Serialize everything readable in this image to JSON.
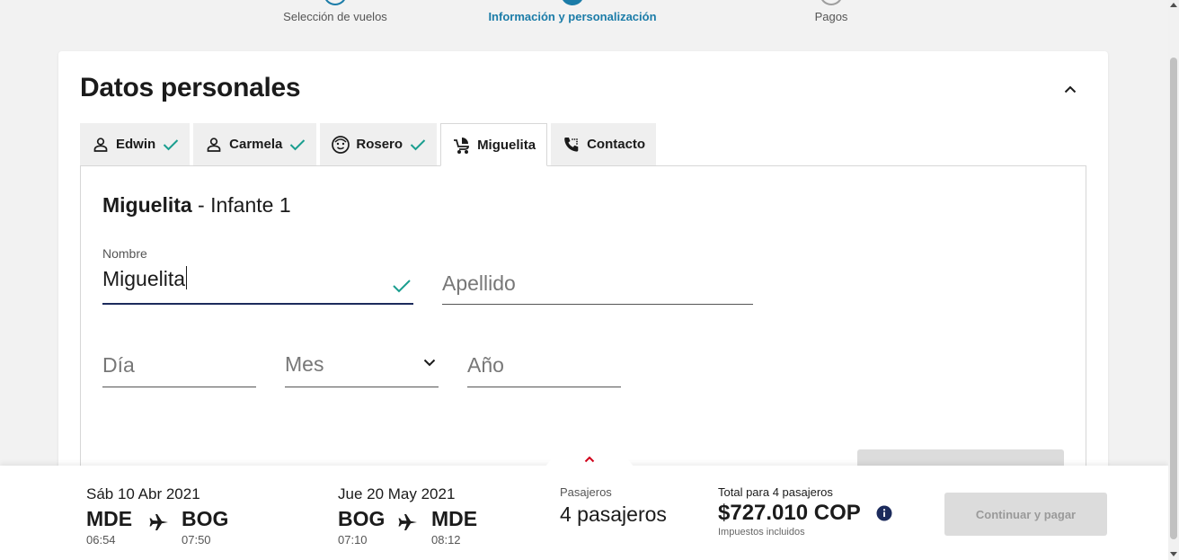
{
  "stepper": {
    "steps": [
      {
        "label": "Selección de vuelos"
      },
      {
        "label": "Información y personalización"
      },
      {
        "label": "Pagos"
      }
    ]
  },
  "card": {
    "title": "Datos personales"
  },
  "tabs": [
    {
      "label": "Edwin",
      "icon": "person-icon",
      "done": true
    },
    {
      "label": "Carmela",
      "icon": "person-icon",
      "done": true
    },
    {
      "label": "Rosero",
      "icon": "child-face-icon",
      "done": true
    },
    {
      "label": "Miguelita",
      "icon": "baby-stroller-icon",
      "done": false
    },
    {
      "label": "Contacto",
      "icon": "phone-icon",
      "done": false
    }
  ],
  "panel": {
    "name": "Miguelita",
    "subtitle": " - Infante 1"
  },
  "form": {
    "first_name_label": "Nombre",
    "first_name_value": "Miguelita",
    "last_name_placeholder": "Apellido",
    "day_placeholder": "Día",
    "month_placeholder": "Mes",
    "year_placeholder": "Año"
  },
  "flights": [
    {
      "date": "Sáb 10 Abr 2021",
      "origin": "MDE",
      "origin_time": "06:54",
      "destination": "BOG",
      "destination_time": "07:50"
    },
    {
      "date": "Jue 20 May 2021",
      "origin": "BOG",
      "origin_time": "07:10",
      "destination": "MDE",
      "destination_time": "08:12"
    }
  ],
  "passengers": {
    "label": "Pasajeros",
    "value": "4 pasajeros"
  },
  "total": {
    "label": "Total para 4 pasajeros",
    "value": "$727.010 COP",
    "note": "Impuestos incluidos"
  },
  "pay_button": "Continuar y pagar",
  "colors": {
    "accent": "#1b7ca8",
    "check": "#1a9e8f",
    "focus_line": "#1c2b5c",
    "notch_arrow": "#d0021b"
  }
}
